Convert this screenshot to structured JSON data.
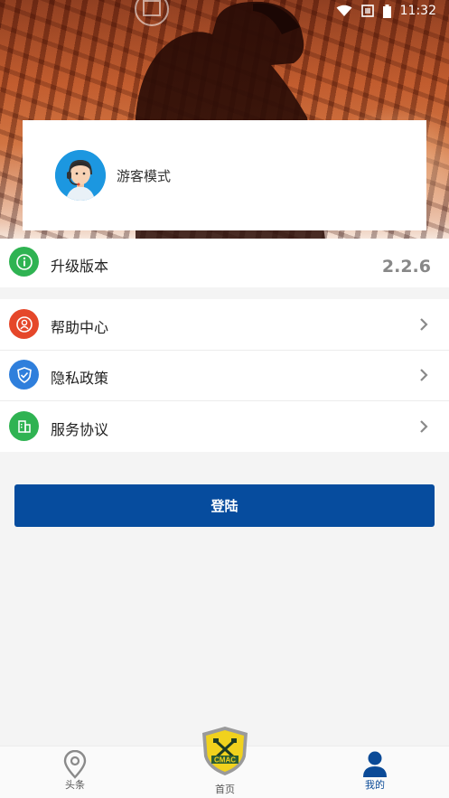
{
  "status_bar": {
    "time": "11:32"
  },
  "profile": {
    "name": "游客模式"
  },
  "version": {
    "label": "升级版本",
    "value": "2.2.6"
  },
  "menu": [
    {
      "label": "帮助中心",
      "icon": "help-center-icon",
      "color": "#e5472a"
    },
    {
      "label": "隐私政策",
      "icon": "shield-icon",
      "color": "#2f7fdc"
    },
    {
      "label": "服务协议",
      "icon": "building-icon",
      "color": "#2fb352"
    }
  ],
  "login": {
    "label": "登陆"
  },
  "tabbar": {
    "tabs": [
      {
        "label": "头条",
        "icon": "location-pin-icon"
      },
      {
        "label": "首页",
        "icon": "cmac-badge-icon",
        "badge_text": "CMAC"
      },
      {
        "label": "我的",
        "icon": "user-icon",
        "active": true
      }
    ]
  },
  "colors": {
    "primary": "#064c9e",
    "active_tab": "#0a4a97",
    "version_green": "#2fb352"
  }
}
